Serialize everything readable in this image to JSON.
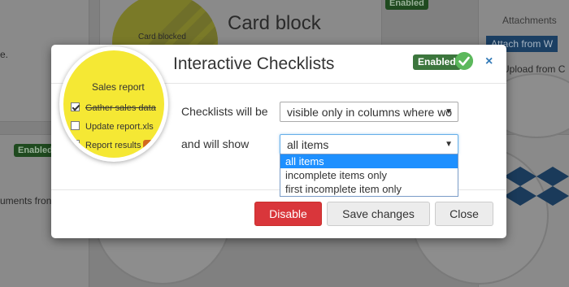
{
  "background": {
    "card_blocked_label": "Card blocked",
    "card_block_title": "Card block",
    "enabled_badge_top": "Enabled",
    "enabled_badge_left": "Enabled",
    "attachments_label": "Attachments",
    "attach_from_label": "Attach from W",
    "upload_from_label": "Upload from C",
    "left_edge_text_top": "e.",
    "left_edge_text_bottom": "uments fron"
  },
  "modal": {
    "title": "Interactive Checklists",
    "enabled_badge": "Enabled",
    "close_icon": "×",
    "checklists_label": "Checklists will be",
    "checklists_value": "visible only in columns where wo",
    "show_label": "and will show",
    "show_value": "all items",
    "show_options": [
      "all items",
      "incomplete items only",
      "first incomplete item only"
    ],
    "show_selected_index": 0,
    "buttons": {
      "disable": "Disable",
      "save": "Save changes",
      "close": "Close"
    }
  },
  "preview": {
    "title": "Sales report",
    "items": [
      {
        "label": "Gather sales data",
        "checked": true
      },
      {
        "label": "Update report.xls",
        "checked": false
      },
      {
        "label": "Report results",
        "checked": false
      }
    ]
  },
  "colors": {
    "enabled_green": "#3c763d",
    "check_green": "#5cb85c",
    "danger_red": "#d9363b",
    "preview_yellow": "#f5e834",
    "selected_blue": "#1e90ff"
  },
  "icons": {
    "close": "close-icon",
    "check": "check-circle-icon",
    "dropdown": "chevron-down-icon",
    "dropbox": "dropbox-icon"
  }
}
